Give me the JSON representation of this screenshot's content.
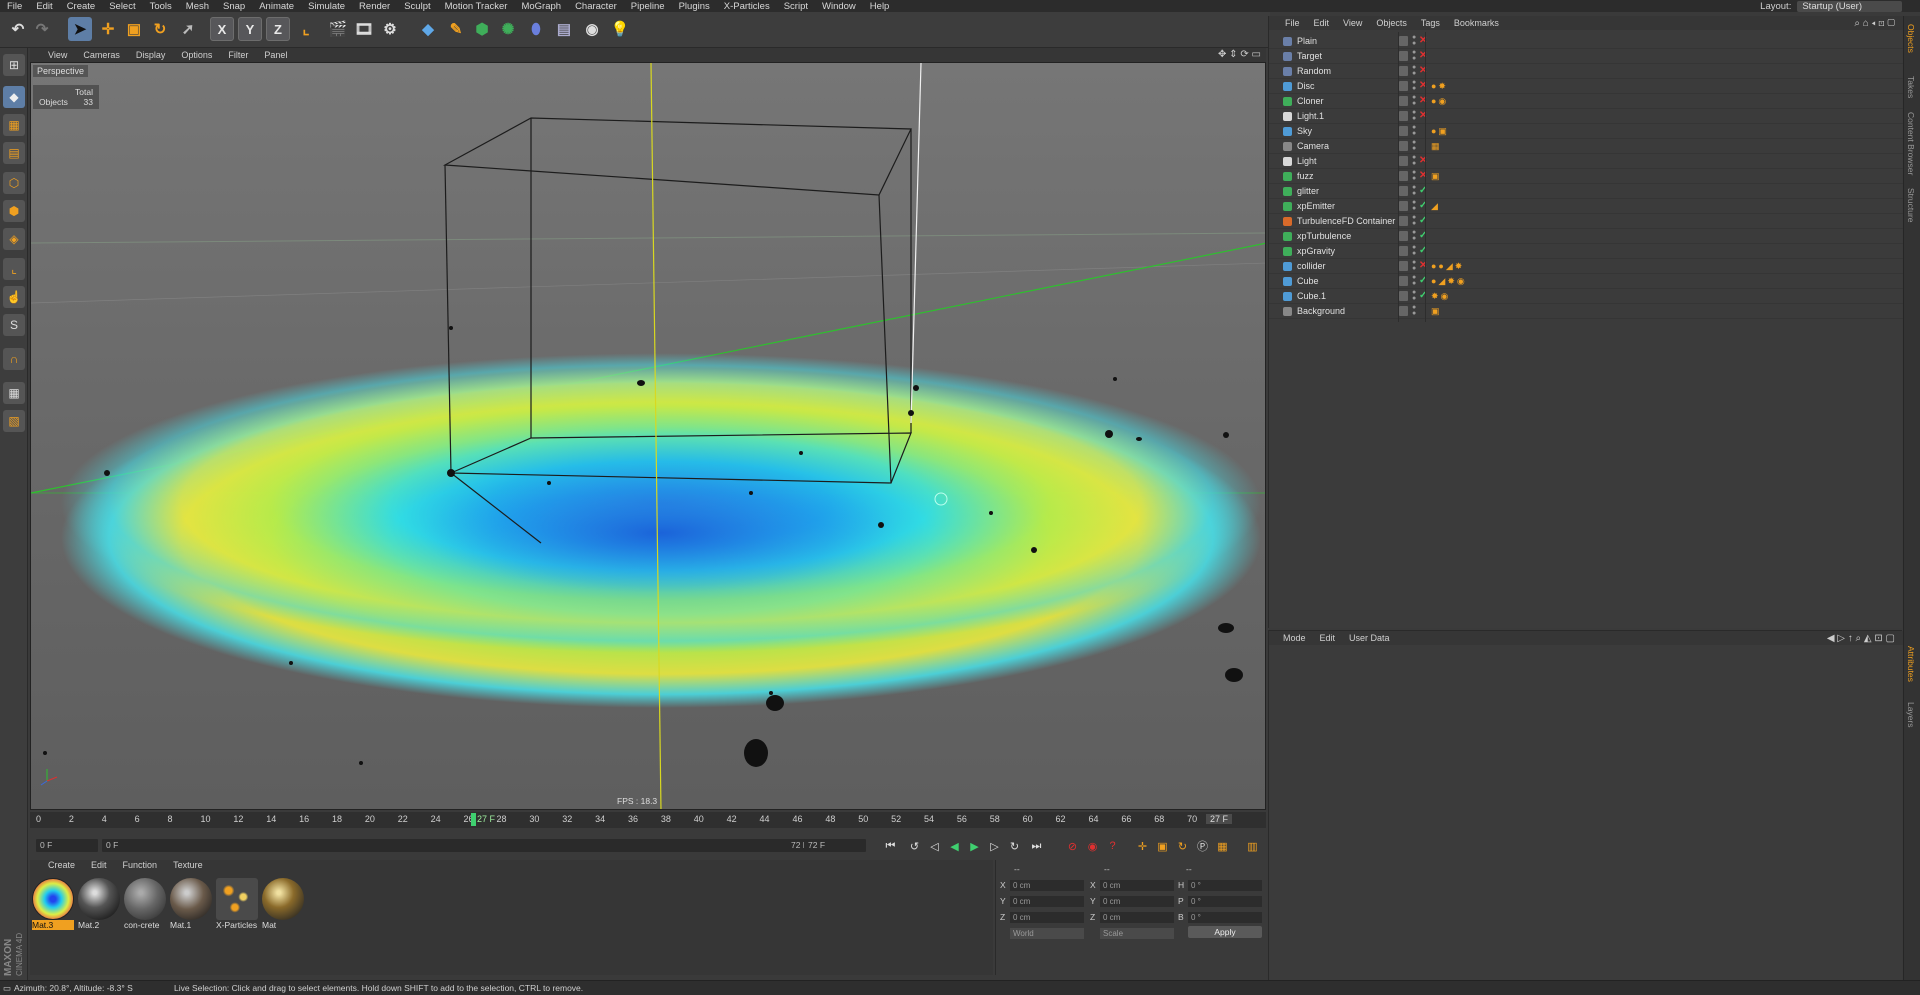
{
  "menubar": [
    "File",
    "Edit",
    "Create",
    "Select",
    "Tools",
    "Mesh",
    "Snap",
    "Animate",
    "Simulate",
    "Render",
    "Sculpt",
    "Motion Tracker",
    "MoGraph",
    "Character",
    "Pipeline",
    "Plugins",
    "X-Particles",
    "Script",
    "Window",
    "Help"
  ],
  "layout": {
    "label": "Layout:",
    "value": "Startup (User)"
  },
  "viewport": {
    "menu": [
      "View",
      "Cameras",
      "Display",
      "Options",
      "Filter",
      "Panel"
    ],
    "label": "Perspective",
    "stats_total": "Total",
    "stats_objects_label": "Objects",
    "stats_objects_value": "33",
    "fps": "FPS : 18.3"
  },
  "timeline": {
    "ticks": [
      "0",
      "2",
      "4",
      "6",
      "8",
      "10",
      "12",
      "14",
      "16",
      "18",
      "20",
      "22",
      "24",
      "26",
      "28",
      "30",
      "32",
      "34",
      "36",
      "38",
      "40",
      "42",
      "44",
      "46",
      "48",
      "50",
      "52",
      "54",
      "56",
      "58",
      "60",
      "62",
      "64",
      "66",
      "68",
      "70",
      "72"
    ],
    "playhead": "27 F",
    "end_frame": "27 F"
  },
  "transport": {
    "start": "0 F",
    "range_start": "0 F",
    "range_end": "72 F",
    "end": "72 F"
  },
  "materials": {
    "menu": [
      "Create",
      "Edit",
      "Function",
      "Texture"
    ],
    "items": [
      "Mat.3",
      "Mat.2",
      "con-crete",
      "Mat.1",
      "X-Particles",
      "Mat"
    ]
  },
  "coords": {
    "headers": [
      "--",
      "--",
      "--"
    ],
    "rows": [
      {
        "a": "X",
        "av": "0 cm",
        "b": "X",
        "bv": "0 cm",
        "c": "H",
        "cv": "0 °"
      },
      {
        "a": "Y",
        "av": "0 cm",
        "b": "Y",
        "bv": "0 cm",
        "c": "P",
        "cv": "0 °"
      },
      {
        "a": "Z",
        "av": "0 cm",
        "b": "Z",
        "bv": "0 cm",
        "c": "B",
        "cv": "0 °"
      }
    ],
    "world": "World",
    "scale": "Scale",
    "apply": "Apply"
  },
  "objects": {
    "menu": [
      "File",
      "Edit",
      "View",
      "Objects",
      "Tags",
      "Bookmarks"
    ],
    "items": [
      {
        "name": "Plain",
        "color": "#6a7fa8",
        "status": "✕",
        "tags": ""
      },
      {
        "name": "Target",
        "color": "#6a7fa8",
        "status": "✕",
        "tags": ""
      },
      {
        "name": "Random",
        "color": "#6a7fa8",
        "status": "✕",
        "tags": ""
      },
      {
        "name": "Disc",
        "color": "#4f9bd6",
        "status": "✕",
        "tags": "●✸"
      },
      {
        "name": "Cloner",
        "color": "#3fae5a",
        "status": "✕",
        "tags": "●◉"
      },
      {
        "name": "Light.1",
        "color": "#d8d8d8",
        "status": "✕",
        "tags": ""
      },
      {
        "name": "Sky",
        "color": "#4f9bd6",
        "status": "",
        "tags": "●▣"
      },
      {
        "name": "Camera",
        "color": "#888888",
        "status": "",
        "tags": "▦"
      },
      {
        "name": "Light",
        "color": "#d8d8d8",
        "status": "✕",
        "tags": ""
      },
      {
        "name": "fuzz",
        "color": "#3fae5a",
        "status": "✕",
        "tags": "▣"
      },
      {
        "name": "glitter",
        "color": "#3fae5a",
        "status": "✓",
        "tags": ""
      },
      {
        "name": "xpEmitter",
        "color": "#3fae5a",
        "status": "✓",
        "tags": "◢"
      },
      {
        "name": "TurbulenceFD Container",
        "color": "#d86a2a",
        "status": "✓",
        "tags": ""
      },
      {
        "name": "xpTurbulence",
        "color": "#3fae5a",
        "status": "✓",
        "tags": ""
      },
      {
        "name": "xpGravity",
        "color": "#3fae5a",
        "status": "✓",
        "tags": ""
      },
      {
        "name": "collider",
        "color": "#4f9bd6",
        "status": "✕",
        "tags": "●●◢✸"
      },
      {
        "name": "Cube",
        "color": "#4f9bd6",
        "status": "✓",
        "tags": "●◢✸◉"
      },
      {
        "name": "Cube.1",
        "color": "#4f9bd6",
        "status": "✓",
        "tags": "✸◉"
      },
      {
        "name": "Background",
        "color": "#888888",
        "status": "",
        "tags": "▣"
      }
    ]
  },
  "attributes": {
    "menu": [
      "Mode",
      "Edit",
      "User Data"
    ]
  },
  "right_tabs": [
    "Objects",
    "Takes",
    "Content Browser",
    "Structure",
    "Attributes",
    "Layers"
  ],
  "status": {
    "angles": "Azimuth: 20.8°, Altitude: -8.3°  S",
    "message": "Live Selection: Click and drag to select elements. Hold down SHIFT to add to the selection, CTRL to remove."
  },
  "brand": {
    "maxon": "MAXON",
    "product": "CINEMA 4D"
  },
  "icons": {
    "undo": "undo-icon",
    "redo": "redo-icon",
    "select": "live-selection-icon",
    "move": "move-icon",
    "scale": "scale-icon",
    "rotate": "rotate-icon"
  },
  "colors": {
    "accent": "#f0a020",
    "selection": "#5e7ea6",
    "x_axis": "#e03030",
    "y_axis": "#d8d820",
    "z_axis": "#2ec02e"
  }
}
